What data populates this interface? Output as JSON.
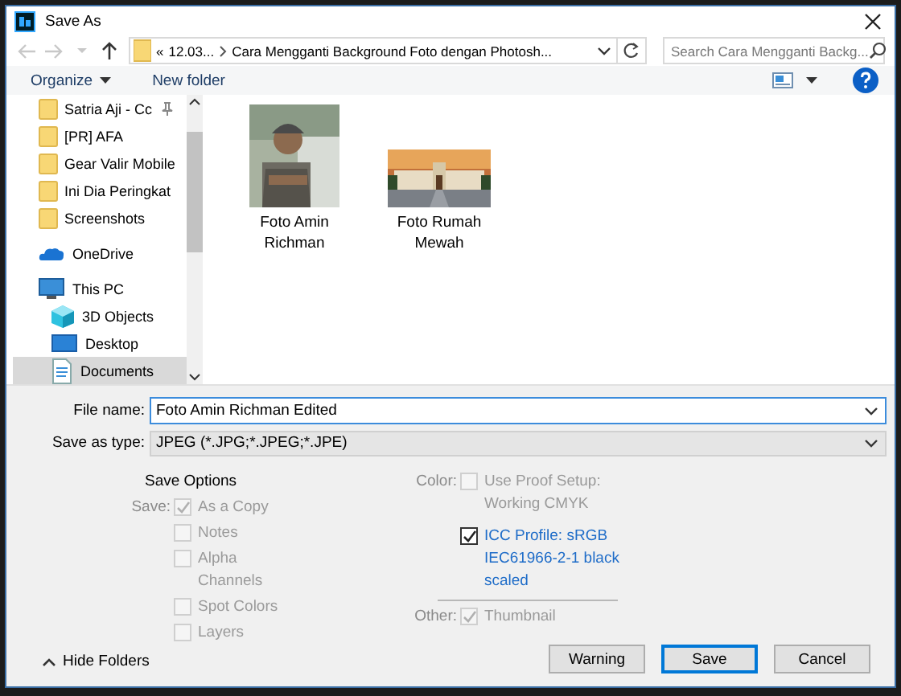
{
  "window": {
    "title": "Save As"
  },
  "nav_buttons": [
    {
      "kind": "back",
      "disabled": true
    },
    {
      "kind": "forward",
      "disabled": true
    },
    {
      "kind": "recent",
      "disabled": true
    },
    {
      "kind": "up",
      "disabled": false
    }
  ],
  "address_bar": {
    "overflow": "«",
    "segments": [
      "12.03...",
      "Cara Mengganti Background Foto dengan Photosh..."
    ]
  },
  "search": {
    "placeholder": "Search Cara Mengganti Backg..."
  },
  "toolbar": {
    "organize": "Organize",
    "new_folder": "New folder"
  },
  "sidebar": {
    "quick_access": [
      {
        "label": "Satria Aji - Cc",
        "pinned": true,
        "selected": false
      },
      {
        "label": "[PR] AFA",
        "pinned": false,
        "selected": false
      },
      {
        "label": "Gear Valir Mobile",
        "pinned": false,
        "selected": false
      },
      {
        "label": "Ini Dia Peringkat",
        "pinned": false,
        "selected": false
      },
      {
        "label": "Screenshots",
        "pinned": false,
        "selected": false
      }
    ],
    "items": [
      {
        "label": "OneDrive",
        "kind": "onedrive",
        "selected": false
      },
      {
        "label": "This PC",
        "kind": "pc",
        "selected": false,
        "children": [
          {
            "label": "3D Objects",
            "kind": "objects3d",
            "selected": false
          },
          {
            "label": "Desktop",
            "kind": "desktop",
            "selected": false
          },
          {
            "label": "Documents",
            "kind": "documents",
            "selected": true
          }
        ]
      }
    ]
  },
  "files": [
    {
      "name": "Foto Amin Richman",
      "kind": "picture"
    },
    {
      "name": "Foto Rumah Mewah",
      "kind": "picture"
    }
  ],
  "form": {
    "file_name_label": "File name:",
    "file_name": "Foto Amin Richman Edited",
    "type_label": "Save as type:",
    "type": "JPEG (*.JPG;*.JPEG;*.JPE)"
  },
  "save_options": {
    "title": "Save Options",
    "save_label": "Save:",
    "options": [
      {
        "label": "As a Copy",
        "checked": true,
        "disabled": true
      },
      {
        "label": "Notes",
        "checked": false,
        "disabled": true
      },
      {
        "label": "Alpha Channels",
        "checked": false,
        "disabled": true
      },
      {
        "label": "Spot Colors",
        "checked": false,
        "disabled": true
      },
      {
        "label": "Layers",
        "checked": false,
        "disabled": true
      }
    ],
    "color_label": "Color:",
    "color_options": [
      {
        "label": "Use Proof Setup: Working CMYK",
        "checked": false,
        "disabled": true
      },
      {
        "label": "ICC Profile:  sRGB IEC61966-2-1 black scaled",
        "checked": true,
        "disabled": false
      }
    ],
    "other_label": "Other:",
    "other_options": [
      {
        "label": "Thumbnail",
        "checked": true,
        "disabled": true
      }
    ]
  },
  "hide_folders": "Hide Folders",
  "buttons": [
    {
      "label": "Warning",
      "default": false
    },
    {
      "label": "Save",
      "default": true
    },
    {
      "label": "Cancel",
      "default": false
    }
  ]
}
